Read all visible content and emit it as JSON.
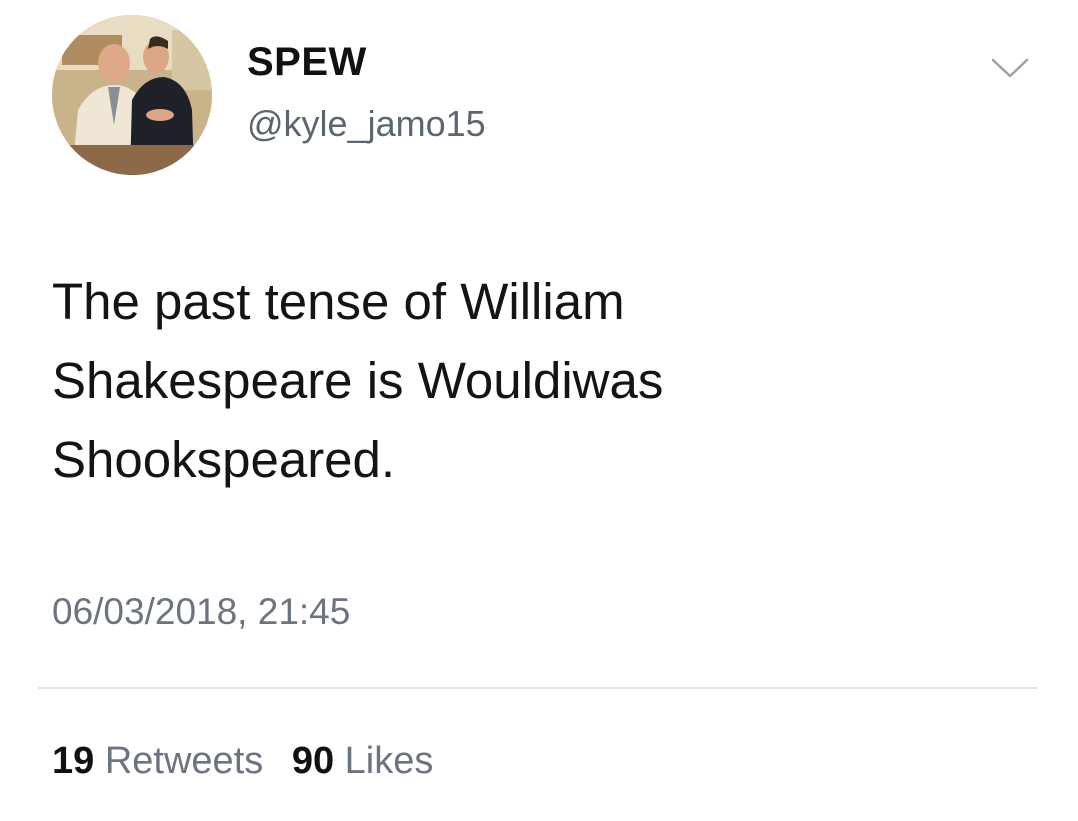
{
  "author": {
    "display_name": "SPEW",
    "handle": "@kyle_jamo15",
    "avatar_icon": "profile-photo"
  },
  "menu": {
    "icon": "chevron-down-icon"
  },
  "tweet": {
    "lines": [
      "The past tense of William",
      "Shakespeare is Wouldiwas",
      "Shookspeared."
    ],
    "timestamp": "06/03/2018, 21:45"
  },
  "stats": {
    "retweets_count": "19",
    "retweets_label": "Retweets",
    "likes_count": "90",
    "likes_label": "Likes"
  },
  "colors": {
    "text": "#141414",
    "secondary": "#6b7480",
    "divider": "#e3e6e9",
    "background": "#ffffff"
  }
}
